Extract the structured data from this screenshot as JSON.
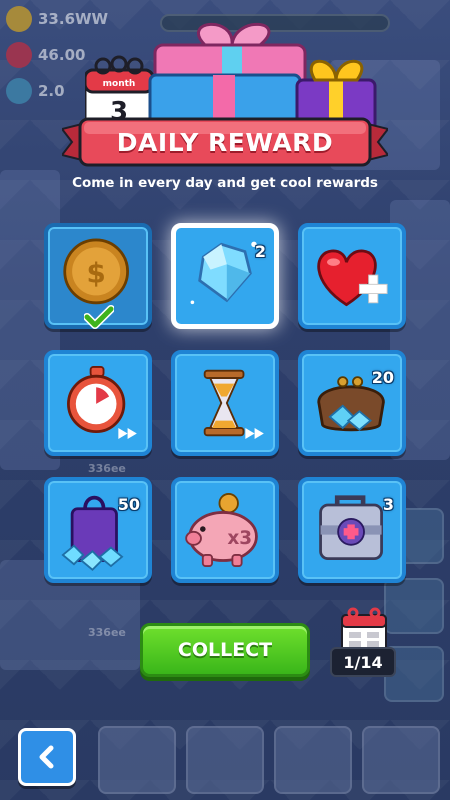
{
  "hud": {
    "coins": "33.6WW",
    "hearts": "46.00",
    "gems": "2.0"
  },
  "background": {
    "floor_label_1": "336ee",
    "floor_label_2": "336ee"
  },
  "header": {
    "calendar_month": "month",
    "calendar_day": "3",
    "title": "DAILY REWARD",
    "subtitle": "Come in every day and get cool rewards"
  },
  "rewards": [
    {
      "item": "coin",
      "quantity": "",
      "state": "claimed"
    },
    {
      "item": "gem",
      "quantity": "2",
      "state": "today"
    },
    {
      "item": "heart",
      "quantity": "",
      "state": "locked"
    },
    {
      "item": "stopwatch-boost",
      "quantity": "",
      "state": "locked"
    },
    {
      "item": "hourglass-boost",
      "quantity": "",
      "state": "locked"
    },
    {
      "item": "gem-purse",
      "quantity": "20",
      "state": "locked"
    },
    {
      "item": "gem-bag",
      "quantity": "50",
      "state": "locked"
    },
    {
      "item": "piggy-bank-x3",
      "quantity": "",
      "state": "locked"
    },
    {
      "item": "medkit-chest",
      "quantity": "3",
      "state": "locked"
    }
  ],
  "piggy_label": "x3",
  "collect_label": "COLLECT",
  "day_counter": "1/14",
  "colors": {
    "tile": "#33a7ee",
    "banner_red": "#e84a5a",
    "collect_green": "#4bc621",
    "back_blue": "#2f8fe6"
  }
}
